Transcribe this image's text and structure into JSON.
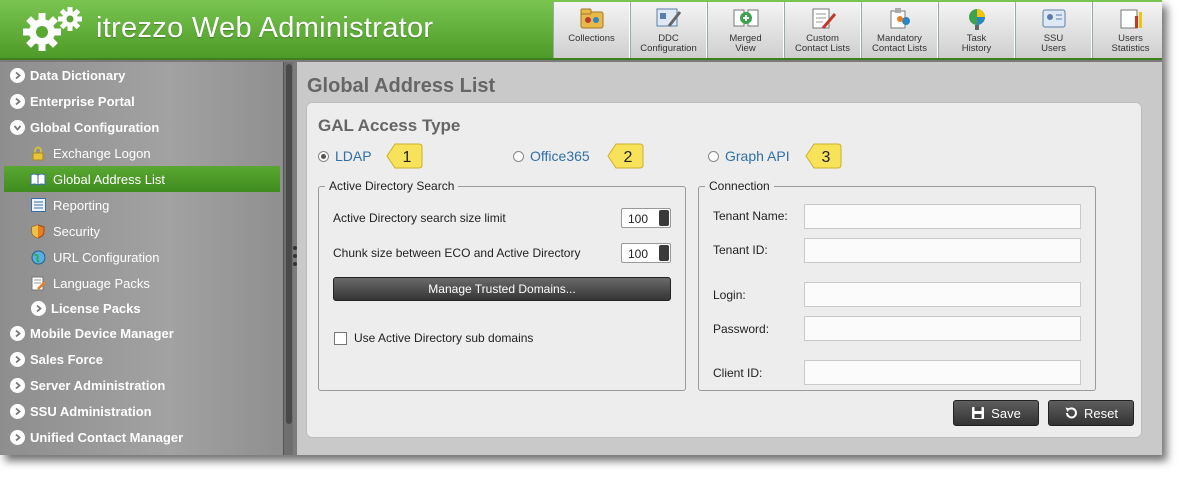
{
  "app": {
    "title": "itrezzo Web Administrator"
  },
  "toolbar": [
    {
      "label": "Collections",
      "icon": "collections-icon"
    },
    {
      "label": "DDC\nConfiguration",
      "icon": "ddc-configuration-icon"
    },
    {
      "label": "Merged\nView",
      "icon": "merged-view-icon"
    },
    {
      "label": "Custom\nContact Lists",
      "icon": "custom-contact-lists-icon"
    },
    {
      "label": "Mandatory\nContact Lists",
      "icon": "mandatory-contact-lists-icon"
    },
    {
      "label": "Task\nHistory",
      "icon": "task-history-icon"
    },
    {
      "label": "SSU\nUsers",
      "icon": "ssu-users-icon"
    },
    {
      "label": "Users\nStatistics",
      "icon": "users-statistics-icon"
    }
  ],
  "sidebar": {
    "items": [
      {
        "label": "Data Dictionary"
      },
      {
        "label": "Enterprise Portal"
      },
      {
        "label": "Global Configuration",
        "expanded": true
      },
      {
        "label": "Exchange Logon",
        "icon": "lock-icon"
      },
      {
        "label": "Global Address List",
        "icon": "book-icon",
        "active": true
      },
      {
        "label": "Reporting",
        "icon": "report-icon"
      },
      {
        "label": "Security",
        "icon": "shield-icon"
      },
      {
        "label": "URL Configuration",
        "icon": "globe-icon"
      },
      {
        "label": "Language Packs",
        "icon": "language-icon"
      },
      {
        "label": "License Packs"
      },
      {
        "label": "Mobile Device Manager"
      },
      {
        "label": "Sales Force"
      },
      {
        "label": "Server Administration"
      },
      {
        "label": "SSU Administration"
      },
      {
        "label": "Unified Contact Manager"
      }
    ]
  },
  "main": {
    "page_title": "Global Address List",
    "gal_title": "GAL Access Type",
    "access_types": [
      {
        "label": "LDAP",
        "selected": true,
        "callout": "1"
      },
      {
        "label": "Office365",
        "selected": false,
        "callout": "2"
      },
      {
        "label": "Graph API",
        "selected": false,
        "callout": "3"
      }
    ],
    "ad_search": {
      "legend": "Active Directory Search",
      "size_limit_label": "Active Directory search size limit",
      "size_limit_value": "100",
      "chunk_label": "Chunk size between ECO and Active Directory",
      "chunk_value": "100",
      "manage_button": "Manage Trusted Domains...",
      "subdomains_label": "Use Active Directory sub domains"
    },
    "connection": {
      "legend": "Connection",
      "tenant_name_label": "Tenant Name:",
      "tenant_id_label": "Tenant ID:",
      "login_label": "Login:",
      "password_label": "Password:",
      "client_id_label": "Client ID:"
    },
    "save_label": "Save",
    "reset_label": "Reset"
  },
  "colors": {
    "header_green": "#5aa832",
    "accent_link": "#2f6fa8",
    "callout_yellow": "#f7e25a"
  }
}
